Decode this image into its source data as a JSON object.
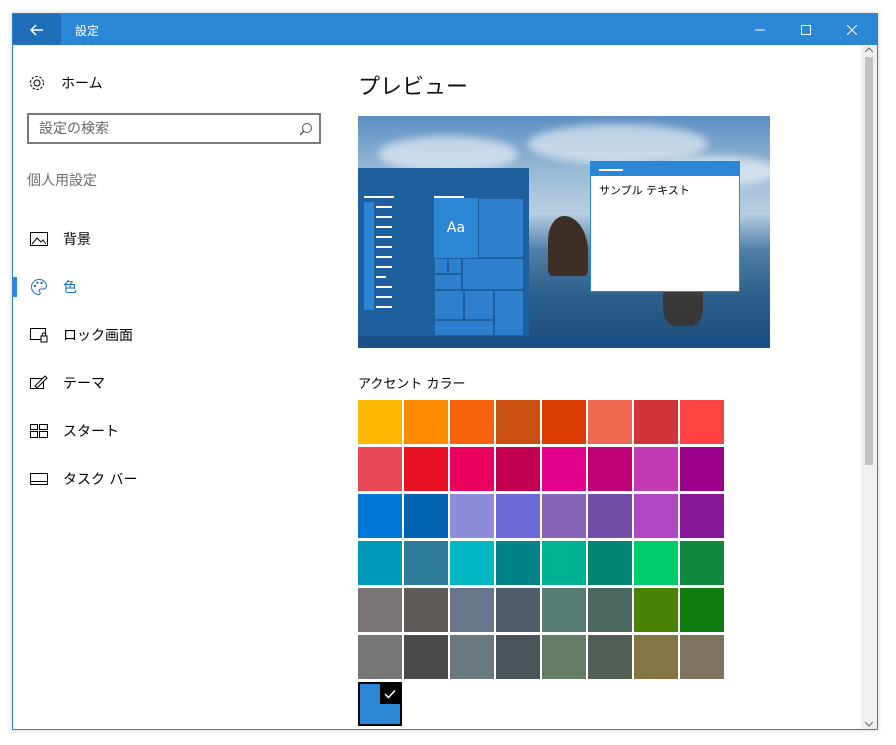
{
  "window": {
    "title": "設定"
  },
  "sidebar": {
    "home_label": "ホーム",
    "search_placeholder": "設定の検索",
    "section_label": "個人用設定",
    "items": [
      {
        "label": "背景",
        "icon": "image-icon"
      },
      {
        "label": "色",
        "icon": "palette-icon",
        "selected": true
      },
      {
        "label": "ロック画面",
        "icon": "lock-screen-icon"
      },
      {
        "label": "テーマ",
        "icon": "theme-icon"
      },
      {
        "label": "スタート",
        "icon": "start-icon"
      },
      {
        "label": "タスク バー",
        "icon": "taskbar-icon"
      }
    ]
  },
  "main": {
    "title": "プレビュー",
    "preview": {
      "tile_text": "Aa",
      "window_text": "サンプル テキスト"
    },
    "accent_label": "アクセント カラー",
    "accent_colors": [
      "#ffb900",
      "#ff8c00",
      "#f7630c",
      "#ca5010",
      "#da3b01",
      "#ef6950",
      "#d13438",
      "#ff4343",
      "#e74856",
      "#e81123",
      "#ea005e",
      "#c30052",
      "#e3008c",
      "#bf0077",
      "#c239b3",
      "#9a0089",
      "#0078d7",
      "#0063b1",
      "#8e8cd8",
      "#6b69d6",
      "#8764b8",
      "#744da9",
      "#b146c2",
      "#881798",
      "#0099bc",
      "#2d7d9a",
      "#00b7c3",
      "#038387",
      "#00b294",
      "#018574",
      "#00cc6a",
      "#10893e",
      "#7a7574",
      "#5d5a58",
      "#68768a",
      "#515c6b",
      "#567c73",
      "#486860",
      "#498205",
      "#107c10",
      "#767676",
      "#4c4a48",
      "#69797e",
      "#4a5459",
      "#647c64",
      "#525e54",
      "#847545",
      "#7e735f"
    ],
    "custom_color": "#2b86d6"
  },
  "colors": {
    "accent": "#2b86d6",
    "titlebar": "#2b86d6"
  }
}
